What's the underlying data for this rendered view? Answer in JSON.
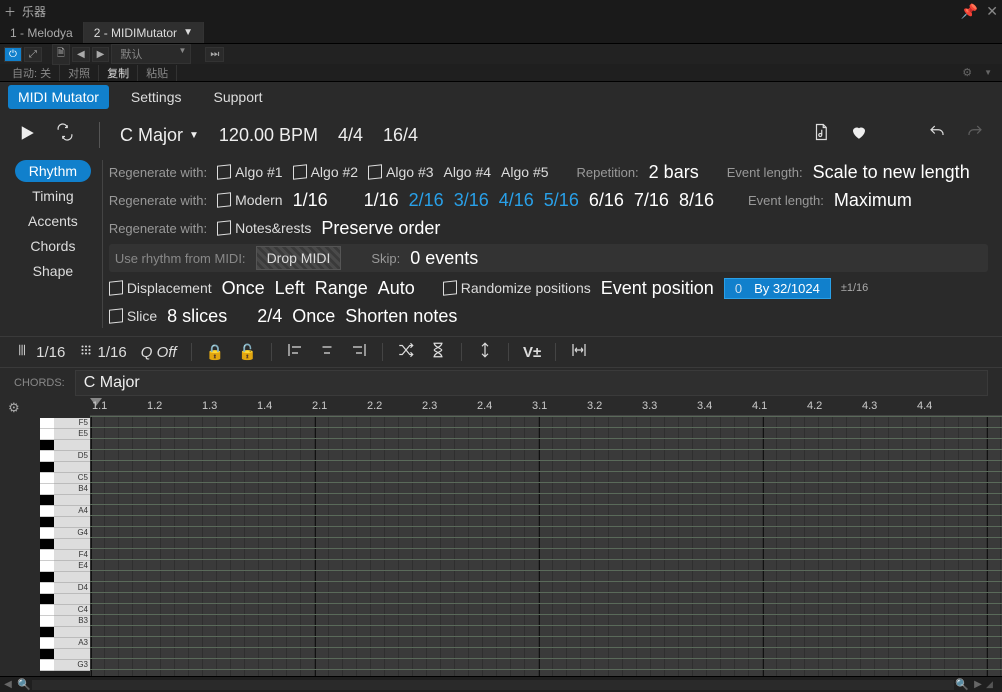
{
  "window": {
    "title": "乐器",
    "tabs": [
      {
        "label": "1 - Melodya",
        "active": false
      },
      {
        "label": "2 - MIDIMutator",
        "active": true
      }
    ]
  },
  "host_toolbar": {
    "preset_label": "默认",
    "auto_section": {
      "label": "自动:",
      "value": "关"
    },
    "compare": "对照",
    "copy": "复制",
    "paste": "粘贴"
  },
  "plugin_tabs": [
    {
      "label": "MIDI Mutator",
      "active": true
    },
    {
      "label": "Settings",
      "active": false
    },
    {
      "label": "Support",
      "active": false
    }
  ],
  "transport": {
    "key": "C Major",
    "bpm": "120.00 BPM",
    "sig1": "4/4",
    "sig2": "16/4"
  },
  "side_pills": [
    "Rhythm",
    "Timing",
    "Accents",
    "Chords",
    "Shape"
  ],
  "side_active": 0,
  "row1": {
    "label": "Regenerate with:",
    "algos": [
      "Algo #1",
      "Algo #2",
      "Algo #3",
      "Algo #4",
      "Algo #5"
    ],
    "hatched": [
      true,
      true,
      true,
      false,
      false
    ],
    "rep_label": "Repetition:",
    "rep_value": "2 bars",
    "evt_label": "Event length:",
    "evt_value": "Scale to new length"
  },
  "row2": {
    "label": "Regenerate with:",
    "style": "Modern",
    "steps": [
      "1/16",
      "1/16",
      "2/16",
      "3/16",
      "4/16",
      "5/16",
      "6/16",
      "7/16",
      "8/16"
    ],
    "blue_from": 2,
    "blue_to": 5,
    "evt_label": "Event length:",
    "evt_value": "Maximum"
  },
  "row3": {
    "label": "Regenerate with:",
    "mode": "Notes&rests",
    "preserve": "Preserve order"
  },
  "row4": {
    "use_label": "Use rhythm from MIDI:",
    "drop": "Drop MIDI",
    "skip_label": "Skip:",
    "skip_value": "0 events"
  },
  "row5": {
    "disp": "Displacement",
    "vals": [
      "Once",
      "Left",
      "Range",
      "Auto"
    ],
    "rand": "Randomize positions",
    "evt": "Event position",
    "box_a": "0",
    "box_b": "By 32/1024",
    "pm": "±1/16"
  },
  "row6": {
    "slice": "Slice",
    "v1": "8 slices",
    "v2": "2/4",
    "v3": "Once",
    "v4": "Shorten notes"
  },
  "tool_row": {
    "snap1": "1/16",
    "snap2": "1/16",
    "q_label": "Q",
    "q_value": "Off"
  },
  "chords": {
    "label": "CHORDS:",
    "value": "C Major"
  },
  "ruler": {
    "ticks": [
      "1.1",
      "1.2",
      "1.3",
      "1.4",
      "2.1",
      "2.2",
      "2.3",
      "2.4",
      "3.1",
      "3.2",
      "3.3",
      "3.4",
      "4.1",
      "4.2",
      "4.3",
      "4.4"
    ]
  },
  "piano": {
    "rows": [
      {
        "k": "F5",
        "b": false
      },
      {
        "k": "E5",
        "b": false
      },
      {
        "k": "",
        "b": true
      },
      {
        "k": "D5",
        "b": false
      },
      {
        "k": "",
        "b": true
      },
      {
        "k": "C5",
        "b": false
      },
      {
        "k": "B4",
        "b": false
      },
      {
        "k": "",
        "b": true
      },
      {
        "k": "A4",
        "b": false
      },
      {
        "k": "",
        "b": true
      },
      {
        "k": "G4",
        "b": false
      },
      {
        "k": "",
        "b": true
      },
      {
        "k": "F4",
        "b": false
      },
      {
        "k": "E4",
        "b": false
      },
      {
        "k": "",
        "b": true
      },
      {
        "k": "D4",
        "b": false
      },
      {
        "k": "",
        "b": true
      },
      {
        "k": "C4",
        "b": false
      },
      {
        "k": "B3",
        "b": false
      },
      {
        "k": "",
        "b": true
      },
      {
        "k": "A3",
        "b": false
      },
      {
        "k": "",
        "b": true
      },
      {
        "k": "G3",
        "b": false
      }
    ]
  }
}
